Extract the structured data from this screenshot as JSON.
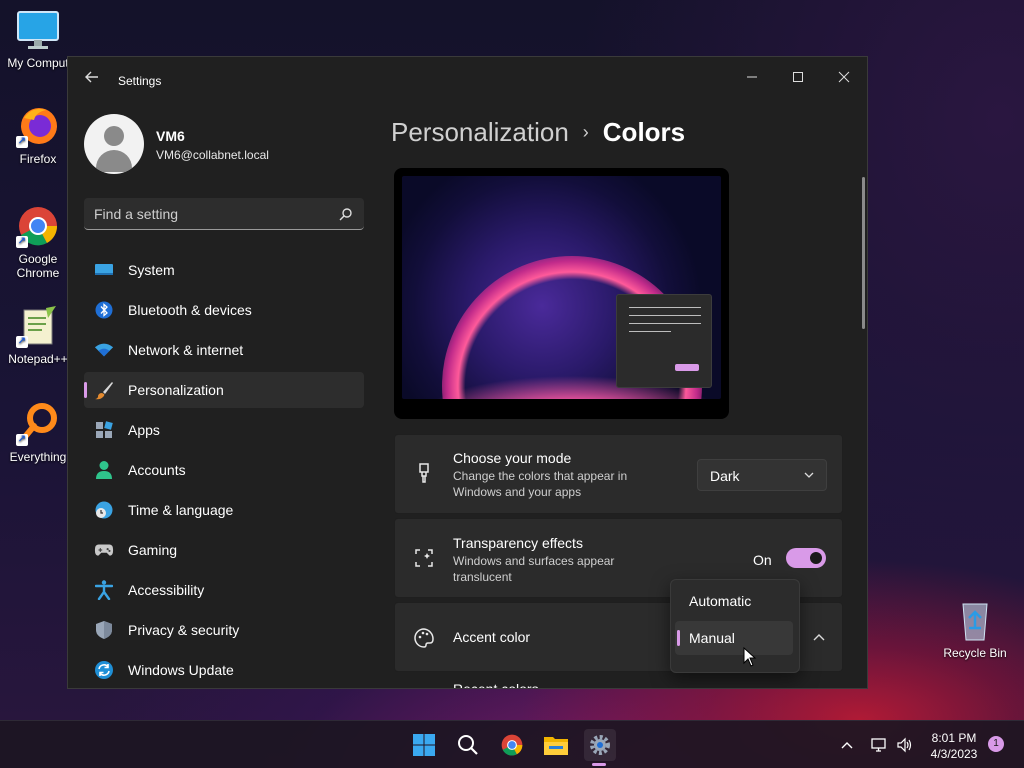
{
  "desktop": {
    "icons": [
      {
        "label": "My Comput",
        "icon": "monitor-icon"
      },
      {
        "label": "Firefox",
        "icon": "firefox-icon"
      },
      {
        "label": "Google Chrome",
        "icon": "chrome-icon"
      },
      {
        "label": "Notepad++",
        "icon": "notepad-plus-plus-icon"
      },
      {
        "label": "Everything",
        "icon": "everything-search-icon"
      },
      {
        "label": "Recycle Bin",
        "icon": "recycle-bin-icon"
      }
    ]
  },
  "window": {
    "title": "Settings",
    "accent_color": "#d99ae8"
  },
  "profile": {
    "name": "VM6",
    "email": "VM6@collabnet.local"
  },
  "search": {
    "placeholder": "Find a setting"
  },
  "sidebar": {
    "items": [
      {
        "label": "System",
        "icon": "system-icon"
      },
      {
        "label": "Bluetooth & devices",
        "icon": "bluetooth-icon"
      },
      {
        "label": "Network & internet",
        "icon": "wifi-icon"
      },
      {
        "label": "Personalization",
        "icon": "paintbrush-icon",
        "active": true
      },
      {
        "label": "Apps",
        "icon": "apps-icon"
      },
      {
        "label": "Accounts",
        "icon": "person-icon"
      },
      {
        "label": "Time & language",
        "icon": "clock-globe-icon"
      },
      {
        "label": "Gaming",
        "icon": "gamepad-icon"
      },
      {
        "label": "Accessibility",
        "icon": "accessibility-icon"
      },
      {
        "label": "Privacy & security",
        "icon": "shield-icon"
      },
      {
        "label": "Windows Update",
        "icon": "update-icon"
      }
    ]
  },
  "breadcrumb": {
    "parent": "Personalization",
    "separator": "›",
    "current": "Colors"
  },
  "settings": {
    "mode": {
      "title": "Choose your mode",
      "subtitle": "Change the colors that appear in Windows and your apps",
      "value": "Dark"
    },
    "transparency": {
      "title": "Transparency effects",
      "subtitle": "Windows and surfaces appear translucent",
      "state_label": "On"
    },
    "accent": {
      "title": "Accent color",
      "options": [
        "Automatic",
        "Manual"
      ],
      "selected": "Manual"
    },
    "recent_colors_label": "Recent colors"
  },
  "taskbar": {
    "apps": [
      "start-icon",
      "search-icon",
      "chrome-icon",
      "file-explorer-icon",
      "settings-gear-icon"
    ],
    "time": "8:01 PM",
    "date": "4/3/2023",
    "notification_count": "1"
  }
}
